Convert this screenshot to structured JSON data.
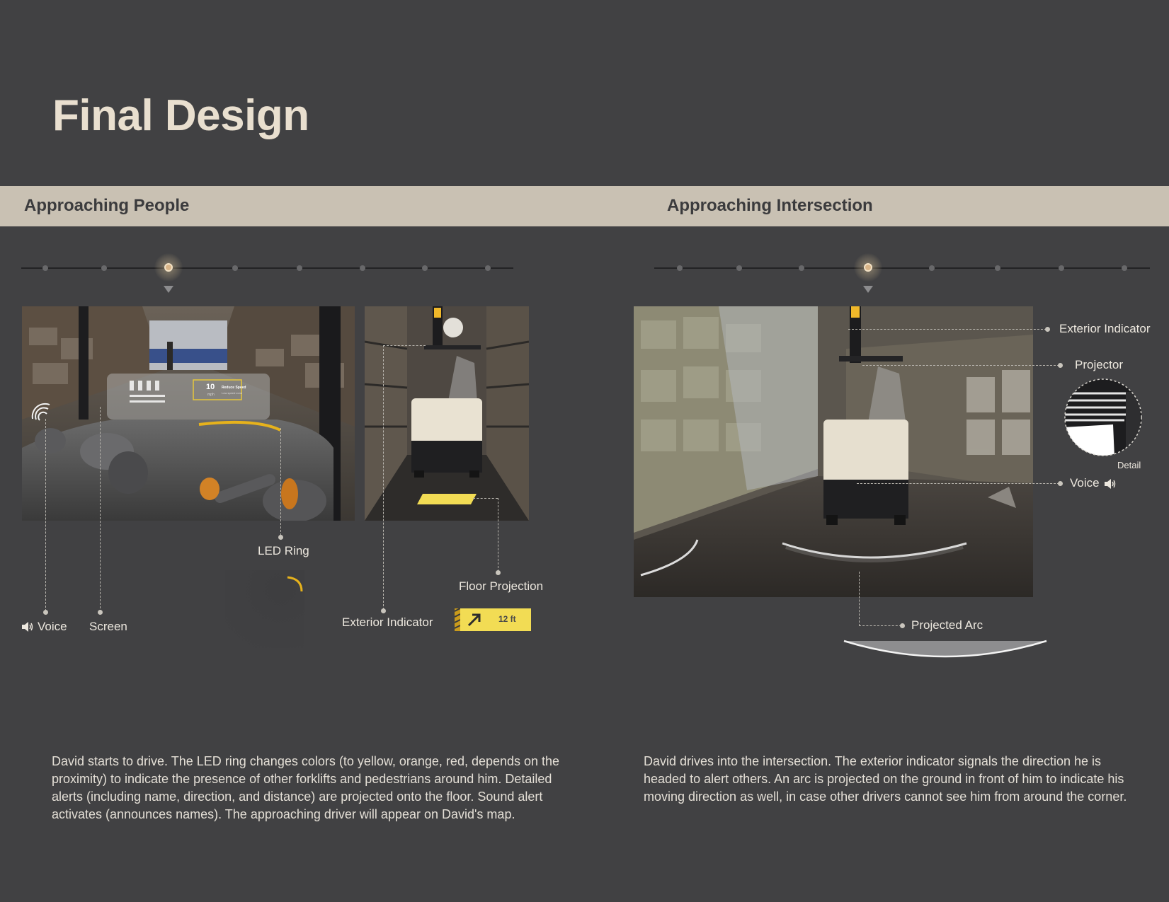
{
  "title": "Final Design",
  "sections": {
    "left": {
      "heading": "Approaching People"
    },
    "right": {
      "heading": "Approaching Intersection"
    }
  },
  "labels": {
    "voice_left": "Voice",
    "screen": "Screen",
    "led_ring": "LED Ring",
    "exterior_indicator_left": "Exterior Indicator",
    "floor_projection": "Floor Projection",
    "exterior_indicator_right": "Exterior Indicator",
    "projector": "Projector",
    "detail": "Detail",
    "voice_right": "Voice",
    "projected_arc": "Projected Arc"
  },
  "hud": {
    "speed": "10",
    "unit": "mph",
    "alert_title": "Reduce Speed",
    "alert_sub": "Low speed zone"
  },
  "floor_badge": {
    "distance": "12 ft"
  },
  "captions": {
    "left": "David starts to drive. The LED ring changes colors (to yellow, orange, red, depends on the proximity) to indicate the presence of other forklifts and pedestrians around him. Detailed alerts (including name, direction, and distance) are projected onto the floor. Sound alert activates (announces names). The approaching driver will appear on David's map.",
    "right": "David drives into the intersection. The exterior indicator signals the direction he is headed to alert others. An arc is projected on the ground in front of him to indicate his moving direction as well, in case other drivers cannot see him from around the corner."
  },
  "colors": {
    "background": "#414143",
    "band": "#c9c1b3",
    "accent_yellow": "#f2dc54",
    "led_yellow": "#e6b21c"
  },
  "icons": [
    "speaker-icon",
    "wireless-signal-icon",
    "arrow-up-right-icon"
  ]
}
